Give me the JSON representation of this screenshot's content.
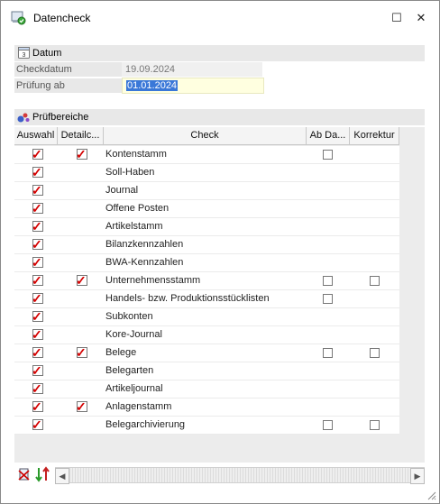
{
  "window": {
    "title": "Datencheck",
    "maximize_glyph": "☐",
    "close_glyph": "✕"
  },
  "datum": {
    "header": "Datum",
    "fields": [
      {
        "label": "Checkdatum",
        "value": "19.09.2024"
      },
      {
        "label": "Prüfung ab",
        "value": "01.01.2024"
      }
    ]
  },
  "pruefbereiche": {
    "header": "Prüfbereiche",
    "columns": [
      "Auswahl",
      "Detailc...",
      "Check",
      "Ab Da...",
      "Korrektur"
    ],
    "rows": [
      {
        "check": "Kontenstamm",
        "auswahl": true,
        "detail": true,
        "ab_datum": "box",
        "korrektur": null
      },
      {
        "check": "Soll-Haben",
        "auswahl": true,
        "detail": false,
        "ab_datum": null,
        "korrektur": null
      },
      {
        "check": "Journal",
        "auswahl": true,
        "detail": false,
        "ab_datum": null,
        "korrektur": null
      },
      {
        "check": "Offene Posten",
        "auswahl": true,
        "detail": false,
        "ab_datum": null,
        "korrektur": null
      },
      {
        "check": "Artikelstamm",
        "auswahl": true,
        "detail": false,
        "ab_datum": null,
        "korrektur": null
      },
      {
        "check": "Bilanzkennzahlen",
        "auswahl": true,
        "detail": false,
        "ab_datum": null,
        "korrektur": null
      },
      {
        "check": "BWA-Kennzahlen",
        "auswahl": true,
        "detail": false,
        "ab_datum": null,
        "korrektur": null
      },
      {
        "check": "Unternehmensstamm",
        "auswahl": true,
        "detail": true,
        "ab_datum": "box",
        "korrektur": "box"
      },
      {
        "check": "Handels- bzw. Produktionsstücklisten",
        "auswahl": true,
        "detail": false,
        "ab_datum": "box",
        "korrektur": null
      },
      {
        "check": "Subkonten",
        "auswahl": true,
        "detail": false,
        "ab_datum": null,
        "korrektur": null
      },
      {
        "check": "Kore-Journal",
        "auswahl": true,
        "detail": false,
        "ab_datum": null,
        "korrektur": null
      },
      {
        "check": "Belege",
        "auswahl": true,
        "detail": true,
        "ab_datum": "box",
        "korrektur": "box"
      },
      {
        "check": "Belegarten",
        "auswahl": true,
        "detail": false,
        "ab_datum": null,
        "korrektur": null
      },
      {
        "check": "Artikeljournal",
        "auswahl": true,
        "detail": false,
        "ab_datum": null,
        "korrektur": null
      },
      {
        "check": "Anlagenstamm",
        "auswahl": true,
        "detail": true,
        "ab_datum": null,
        "korrektur": null
      },
      {
        "check": "Belegarchivierung",
        "auswahl": true,
        "detail": false,
        "ab_datum": "box",
        "korrektur": "box"
      }
    ]
  },
  "footer": {
    "icons": [
      "deselect-all-icon",
      "toggle-selection-icon"
    ]
  },
  "colors": {
    "check_red": "#d40000",
    "selection_blue": "#3a78d8",
    "edit_yellow": "#ffffe0"
  }
}
